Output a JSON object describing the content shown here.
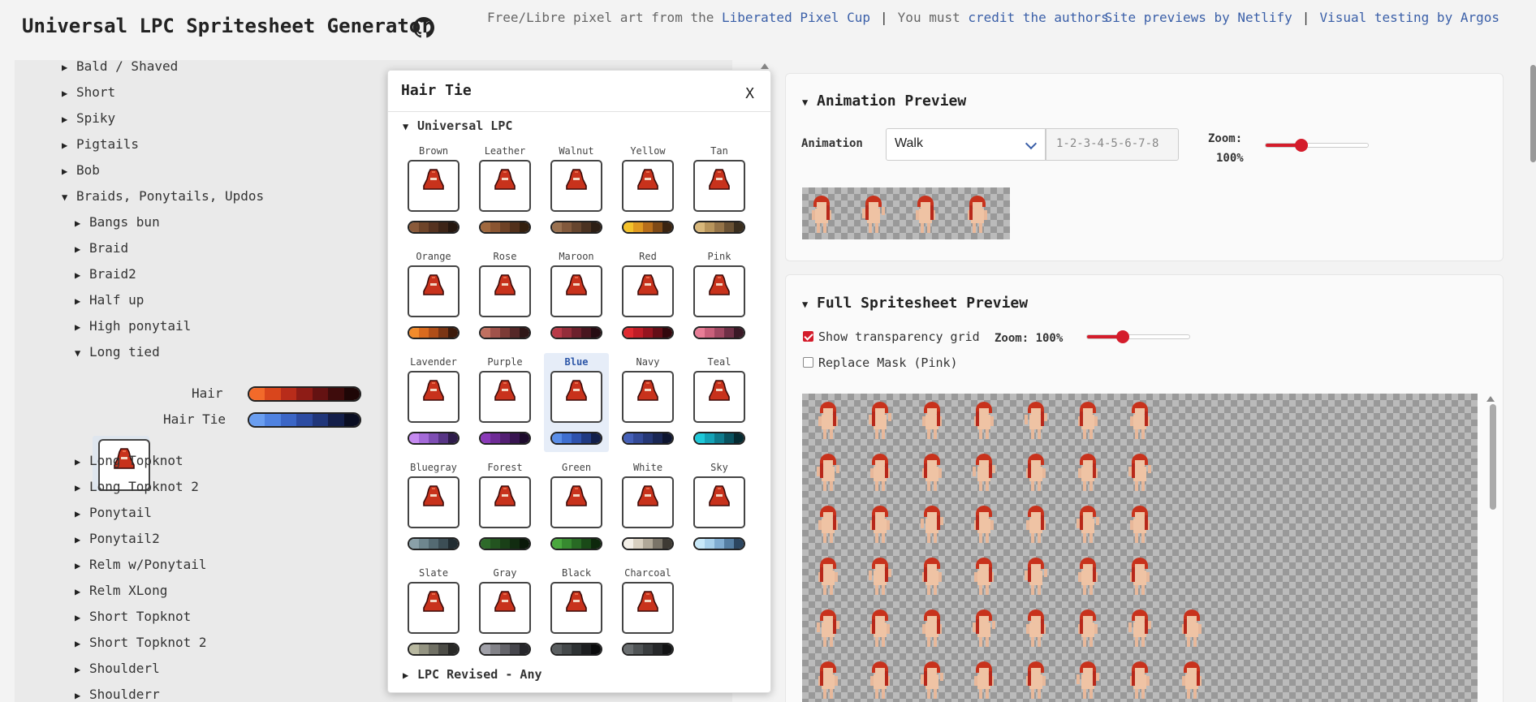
{
  "header": {
    "title": "Universal LPC Spritesheet Generator",
    "credit_prefix": "Free/Libre pixel art from the",
    "credit_link1": "Liberated Pixel Cup",
    "credit_mid": "You must",
    "credit_link2": "credit the authors",
    "link_netlify": "Site previews by Netlify",
    "link_argos": "Visual testing by Argos",
    "separator": "|"
  },
  "tree": {
    "top_items": [
      "Bald / Shaved",
      "Short",
      "Spiky",
      "Pigtails",
      "Bob"
    ],
    "group": "Braids, Ponytails, Updos",
    "group_items_before": [
      "Bangs bun",
      "Braid",
      "Braid2",
      "Half up",
      "High ponytail"
    ],
    "open_item": "Long tied",
    "swatch_hair_label": "Hair",
    "swatch_tie_label": "Hair Tie",
    "group_items_after": [
      "Long Topknot",
      "Long Topknot 2",
      "Ponytail",
      "Ponytail2",
      "Relm w/Ponytail",
      "Relm XLong",
      "Short Topknot",
      "Short Topknot 2",
      "Shoulderl",
      "Shoulderr"
    ]
  },
  "modal": {
    "title": "Hair Tie",
    "close": "X",
    "section1": "Universal LPC",
    "section2": "LPC Revised - Any",
    "selected": "Blue",
    "colors": [
      {
        "name": "Brown",
        "pal": [
          "#8a5a3a",
          "#6e4429",
          "#553220",
          "#3d2417",
          "#24160e"
        ]
      },
      {
        "name": "Leather",
        "pal": [
          "#a0683e",
          "#8a5532",
          "#6e4226",
          "#52301b",
          "#33200f"
        ]
      },
      {
        "name": "Walnut",
        "pal": [
          "#9a7150",
          "#82593c",
          "#66452e",
          "#4b3221",
          "#2c1e14"
        ]
      },
      {
        "name": "Yellow",
        "pal": [
          "#f4c22b",
          "#e09a21",
          "#b76e1b",
          "#7e4a17",
          "#3a2411"
        ]
      },
      {
        "name": "Tan",
        "pal": [
          "#d8b77a",
          "#b8955c",
          "#957448",
          "#6a5234",
          "#3a2e1e"
        ]
      },
      {
        "name": "Orange",
        "pal": [
          "#f28b2b",
          "#d96a1e",
          "#b04e18",
          "#7a3514",
          "#3d1b0c"
        ]
      },
      {
        "name": "Rose",
        "pal": [
          "#c07060",
          "#a0524a",
          "#7c3b36",
          "#552727",
          "#2e1616"
        ]
      },
      {
        "name": "Maroon",
        "pal": [
          "#b83a48",
          "#932d3a",
          "#6c202c",
          "#48161f",
          "#260c12"
        ]
      },
      {
        "name": "Red",
        "pal": [
          "#e02a30",
          "#bf1d27",
          "#95141f",
          "#640e17",
          "#33080d"
        ]
      },
      {
        "name": "Pink",
        "pal": [
          "#e87d96",
          "#c9607b",
          "#a04862",
          "#6e3046",
          "#3a1926"
        ]
      },
      {
        "name": "Lavender",
        "pal": [
          "#c58af0",
          "#a46ad8",
          "#7e4eb3",
          "#573585",
          "#2e1c4a"
        ]
      },
      {
        "name": "Purple",
        "pal": [
          "#8a3ab8",
          "#6e2b96",
          "#531f73",
          "#381551",
          "#1d0b2c"
        ]
      },
      {
        "name": "Blue",
        "pal": [
          "#5a8ee8",
          "#3f6fd0",
          "#2e52ad",
          "#203a82",
          "#121f4a"
        ]
      },
      {
        "name": "Navy",
        "pal": [
          "#4560b8",
          "#344b98",
          "#263876",
          "#1a2754",
          "#0e152f"
        ]
      },
      {
        "name": "Teal",
        "pal": [
          "#1ec8d8",
          "#14a2b6",
          "#0e7a8c",
          "#09525f",
          "#052a31"
        ]
      },
      {
        "name": "Bluegray",
        "pal": [
          "#8aa0a8",
          "#6e868e",
          "#546a72",
          "#3c4e55",
          "#222d32"
        ]
      },
      {
        "name": "Forest",
        "pal": [
          "#2e6a2a",
          "#235420",
          "#1a4018",
          "#122c11",
          "#0a1809"
        ]
      },
      {
        "name": "Green",
        "pal": [
          "#4aa83e",
          "#378a30",
          "#286a24",
          "#1a4a18",
          "#0d280c"
        ]
      },
      {
        "name": "White",
        "pal": [
          "#f4f0e8",
          "#d8d0c0",
          "#b0a898",
          "#7a7468",
          "#3e3a34"
        ]
      },
      {
        "name": "Sky",
        "pal": [
          "#c8e8f8",
          "#a8d0ea",
          "#80acd0",
          "#557ea2",
          "#2c4660"
        ]
      },
      {
        "name": "Slate",
        "pal": [
          "#b8b8a0",
          "#949482",
          "#707064",
          "#4c4c46",
          "#282826"
        ]
      },
      {
        "name": "Gray",
        "pal": [
          "#a0a0a8",
          "#828288",
          "#64646a",
          "#46464c",
          "#26262a"
        ]
      },
      {
        "name": "Black",
        "pal": [
          "#5a5e60",
          "#44484a",
          "#2e3234",
          "#1c1e20",
          "#0a0b0c"
        ]
      },
      {
        "name": "Charcoal",
        "pal": [
          "#6a6e70",
          "#505456",
          "#3a3d3f",
          "#26282a",
          "#121314"
        ]
      }
    ]
  },
  "animation": {
    "title": "Animation Preview",
    "label": "Animation",
    "value": "Walk",
    "frames": "1-2-3-4-5-6-7-8",
    "zoom_label": "Zoom:",
    "zoom_value": "100%",
    "zoom_fraction": 0.35
  },
  "full": {
    "title": "Full Spritesheet Preview",
    "show_grid_label": "Show transparency grid",
    "show_grid": true,
    "zoom_label": "Zoom: 100%",
    "zoom_fraction": 0.35,
    "replace_mask_label": "Replace Mask (Pink)",
    "replace_mask": false,
    "row_counts": [
      7,
      7,
      7,
      7,
      8,
      8
    ]
  },
  "hair_palette": [
    "#f26a2a",
    "#d9461c",
    "#b82c1a",
    "#8e1c16",
    "#641212",
    "#3e0c0c",
    "#1e0606"
  ],
  "tie_palette": [
    "#6a9ef0",
    "#4f82e0",
    "#3b66c6",
    "#2c4ca2",
    "#20367a",
    "#141f4a",
    "#0a0e22"
  ],
  "colors": {
    "accent": "#d41c2b",
    "link": "#3a5fa8",
    "hair": "#c8321c"
  }
}
